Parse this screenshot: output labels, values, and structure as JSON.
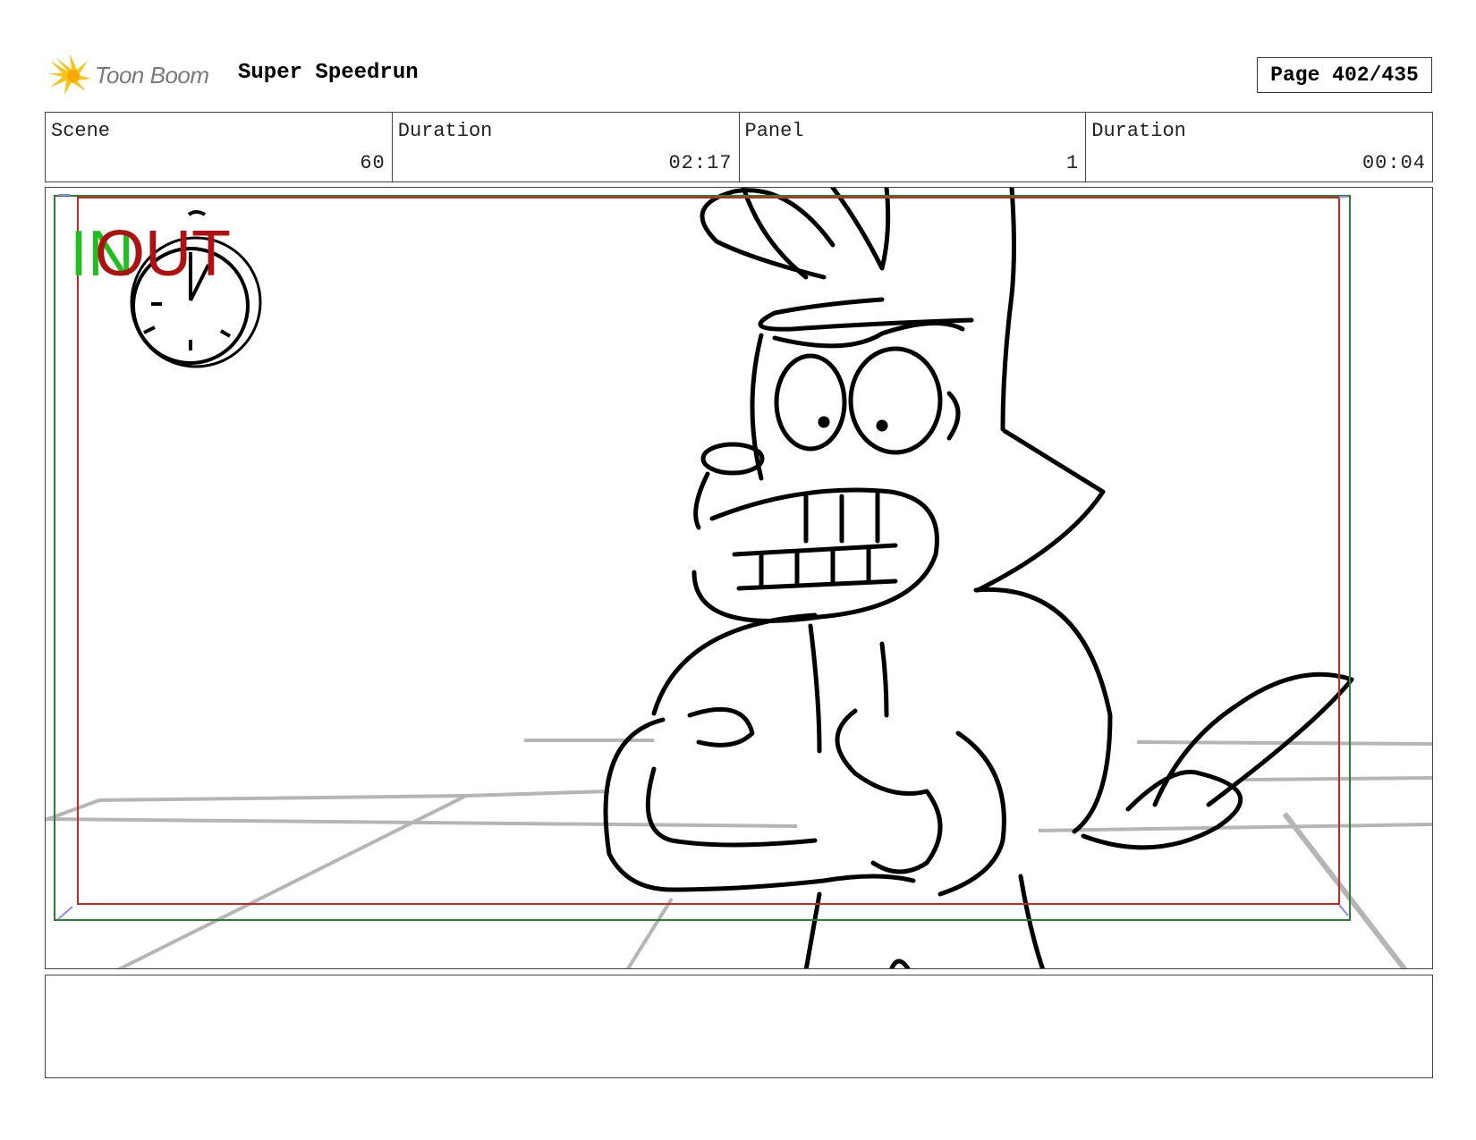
{
  "header": {
    "logo_text": "Toon Boom",
    "project_title": "Super Speedrun",
    "page_label": "Page 402/435"
  },
  "info": {
    "scene_label": "Scene",
    "scene_value": "60",
    "scene_duration_label": "Duration",
    "scene_duration_value": "02:17",
    "panel_label": "Panel",
    "panel_value": "1",
    "panel_duration_label": "Duration",
    "panel_duration_value": "00:04"
  },
  "panel": {
    "in_marker": "IN",
    "out_marker": "OUT"
  },
  "notes": {
    "text": ""
  },
  "colors": {
    "in_green": "#1fbf1f",
    "out_red": "#b01010",
    "safe_frame_green": "#2e7d32",
    "action_frame_red": "#c62828",
    "logo_yellow": "#f5c518"
  }
}
